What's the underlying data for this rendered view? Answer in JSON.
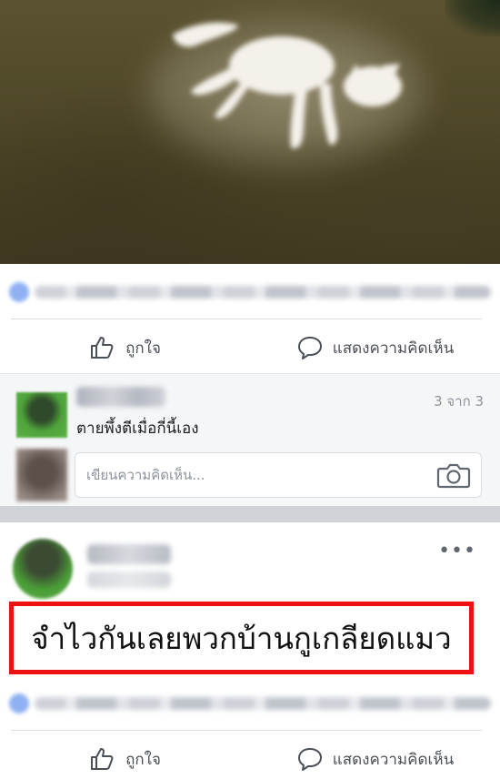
{
  "post1": {
    "actions": {
      "like_label": "ถูกใจ",
      "comment_label": "แสดงความคิดเห็น"
    }
  },
  "comments": {
    "count_label": "3 จาก 3",
    "text": "ตายพึ้งตีเมื่อกี่นี้เอง",
    "input_placeholder": "เขียนความคิดเห็น..."
  },
  "post2": {
    "text": "จำไวกันเลยพวกบ้านกูเกลียดแมว",
    "actions": {
      "like_label": "ถูกใจ",
      "comment_label": "แสดงความคิดเห็น"
    }
  },
  "colors": {
    "highlight_border": "#ee1111",
    "secondary_text": "#4b4f56",
    "muted_text": "#8d949e"
  },
  "icons": {
    "like": "thumbs-up-icon",
    "comment": "speech-bubble-icon",
    "camera": "camera-icon",
    "more": "more-dots-icon"
  }
}
